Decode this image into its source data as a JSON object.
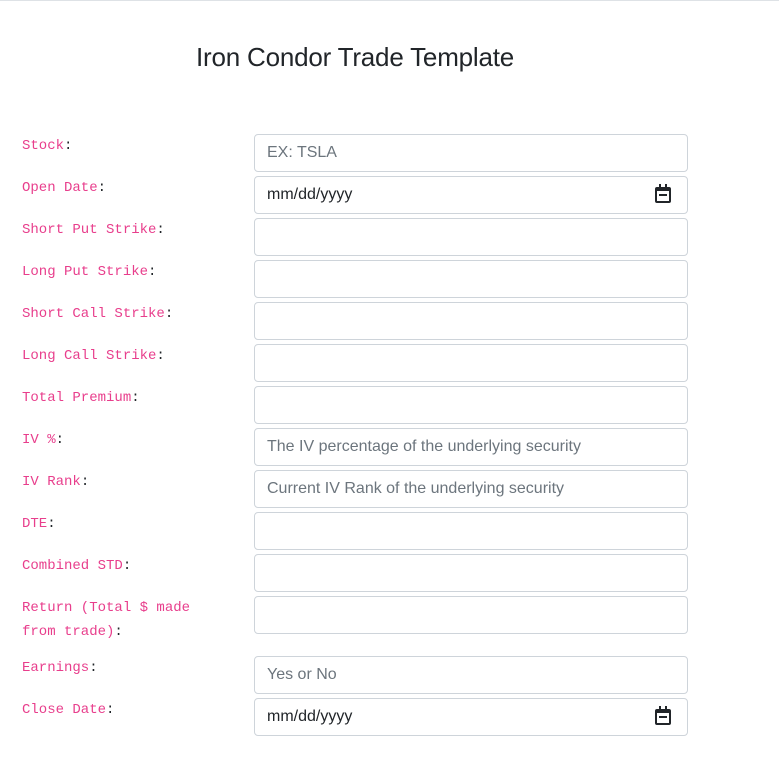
{
  "page": {
    "title": "Iron Condor Trade Template"
  },
  "rows": [
    {
      "label": "Stock",
      "placeholder": "EX: TSLA",
      "type": "text"
    },
    {
      "label": "Open Date",
      "placeholder": "mm/dd/yyyy",
      "type": "date"
    },
    {
      "label": "Short Put Strike",
      "placeholder": "",
      "type": "text"
    },
    {
      "label": "Long Put Strike",
      "placeholder": "",
      "type": "text"
    },
    {
      "label": "Short Call Strike",
      "placeholder": "",
      "type": "text"
    },
    {
      "label": "Long Call Strike",
      "placeholder": "",
      "type": "text"
    },
    {
      "label": "Total Premium",
      "placeholder": "",
      "type": "text"
    },
    {
      "label": "IV %",
      "placeholder": "The IV percentage of the underlying security",
      "type": "text"
    },
    {
      "label": "IV Rank",
      "placeholder": "Current IV Rank of the underlying security",
      "type": "text"
    },
    {
      "label": "DTE",
      "placeholder": "",
      "type": "text"
    },
    {
      "label": "Combined STD",
      "placeholder": "",
      "type": "text"
    },
    {
      "label": "Return (Total $ made from trade)",
      "placeholder": "",
      "type": "text"
    },
    {
      "label": "Earnings",
      "placeholder": "Yes or No",
      "type": "text"
    },
    {
      "label": "Close Date",
      "placeholder": "mm/dd/yyyy",
      "type": "date"
    }
  ],
  "colors": {
    "label_code": "#e83e8c",
    "border": "#ced4da",
    "placeholder": "#6c757d"
  },
  "icons": {
    "date_picker": "calendar-icon"
  }
}
